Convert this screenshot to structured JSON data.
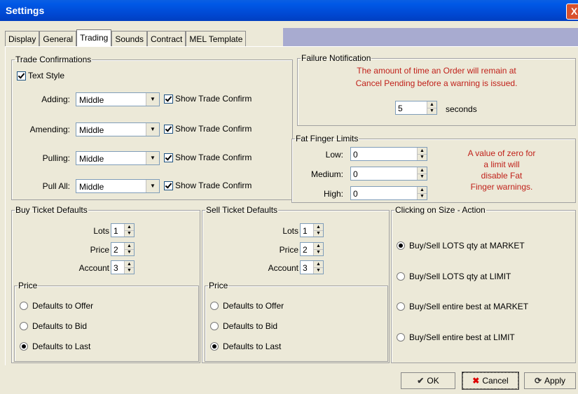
{
  "window": {
    "title": "Settings",
    "close_label": "X"
  },
  "tabs": [
    "Display",
    "General",
    "Trading",
    "Sounds",
    "Contract",
    "MEL Template"
  ],
  "trade_confirmations": {
    "legend": "Trade Confirmations",
    "text_style": {
      "label": "Text Style",
      "checked": true
    },
    "rows": [
      {
        "label": "Adding:",
        "value": "Middle",
        "show_label": "Show Trade Confirm",
        "checked": true
      },
      {
        "label": "Amending:",
        "value": "Middle",
        "show_label": "Show Trade Confirm",
        "checked": true
      },
      {
        "label": "Pulling:",
        "value": "Middle",
        "show_label": "Show Trade Confirm",
        "checked": true
      },
      {
        "label": "Pull All:",
        "value": "Middle",
        "show_label": "Show Trade Confirm",
        "checked": true
      }
    ]
  },
  "failure_notification": {
    "legend": "Failure Notification",
    "message_line1": "The amount of time an Order will remain at",
    "message_line2": "Cancel Pending before a warning is issued.",
    "value": "5",
    "unit": "seconds"
  },
  "fat_finger": {
    "legend": "Fat Finger Limits",
    "rows": [
      {
        "label": "Low:",
        "value": "0"
      },
      {
        "label": "Medium:",
        "value": "0"
      },
      {
        "label": "High:",
        "value": "0"
      }
    ],
    "note_lines": [
      "A value of zero for",
      "a limit will",
      "disable Fat",
      "Finger warnings."
    ]
  },
  "buy_ticket": {
    "legend": "Buy Ticket Defaults",
    "lots_label": "Lots",
    "lots": "1",
    "price_label": "Price",
    "price": "2",
    "account_label": "Account",
    "account": "3",
    "price_group": "Price",
    "options": [
      "Defaults to Offer",
      "Defaults to Bid",
      "Defaults to Last"
    ],
    "selected": 2
  },
  "sell_ticket": {
    "legend": "Sell Ticket Defaults",
    "lots_label": "Lots",
    "lots": "1",
    "price_label": "Price",
    "price": "2",
    "account_label": "Account",
    "account": "3",
    "price_group": "Price",
    "options": [
      "Defaults to Offer",
      "Defaults to Bid",
      "Defaults to Last"
    ],
    "selected": 2
  },
  "clicking_size": {
    "legend": "Clicking on Size - Action",
    "options": [
      "Buy/Sell LOTS qty at MARKET",
      "Buy/Sell LOTS qty at LIMIT",
      "Buy/Sell entire best at MARKET",
      "Buy/Sell entire best at LIMIT"
    ],
    "selected": 0
  },
  "buttons": {
    "ok": "OK",
    "cancel": "Cancel",
    "apply": "Apply"
  },
  "colors": {
    "titlebar": "#0047d1",
    "accent_red": "#c0211a",
    "tab_band": "#a8abd0"
  }
}
